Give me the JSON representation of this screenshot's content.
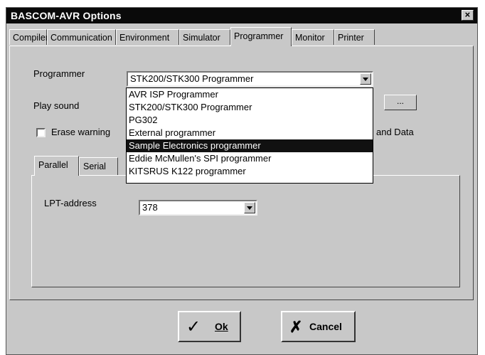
{
  "window": {
    "title": "BASCOM-AVR Options"
  },
  "tabs": [
    "Compiler",
    "Communication",
    "Environment",
    "Simulator",
    "Programmer",
    "Monitor",
    "Printer"
  ],
  "programmer": {
    "label": "Programmer",
    "selected": "STK200/STK300 Programmer",
    "play_sound_label": "Play sound",
    "browse_label": "...",
    "erase_warning_label": "Erase warning",
    "code_data_label": "and Data",
    "dropdown_options": [
      "AVR ISP Programmer",
      "STK200/STK300 Programmer",
      "PG302",
      "External programmer",
      "Sample Electronics programmer",
      "Eddie McMullen's SPI programmer",
      "KITSRUS K122 programmer"
    ],
    "highlighted_option_index": 4
  },
  "inner_tabs": [
    "Parallel",
    "Serial"
  ],
  "parallel": {
    "lpt_label": "LPT-address",
    "lpt_value": "378"
  },
  "buttons": {
    "ok_label": "Ok",
    "cancel_label": "Cancel"
  },
  "icons": {
    "ok": "checkmark-icon",
    "cancel": "x-icon",
    "close": "close-icon",
    "dropdown": "chevron-down-icon"
  },
  "colors": {
    "titlebar": "#0a0a0a",
    "face": "#c8c8c8",
    "highlight": "#111111"
  }
}
